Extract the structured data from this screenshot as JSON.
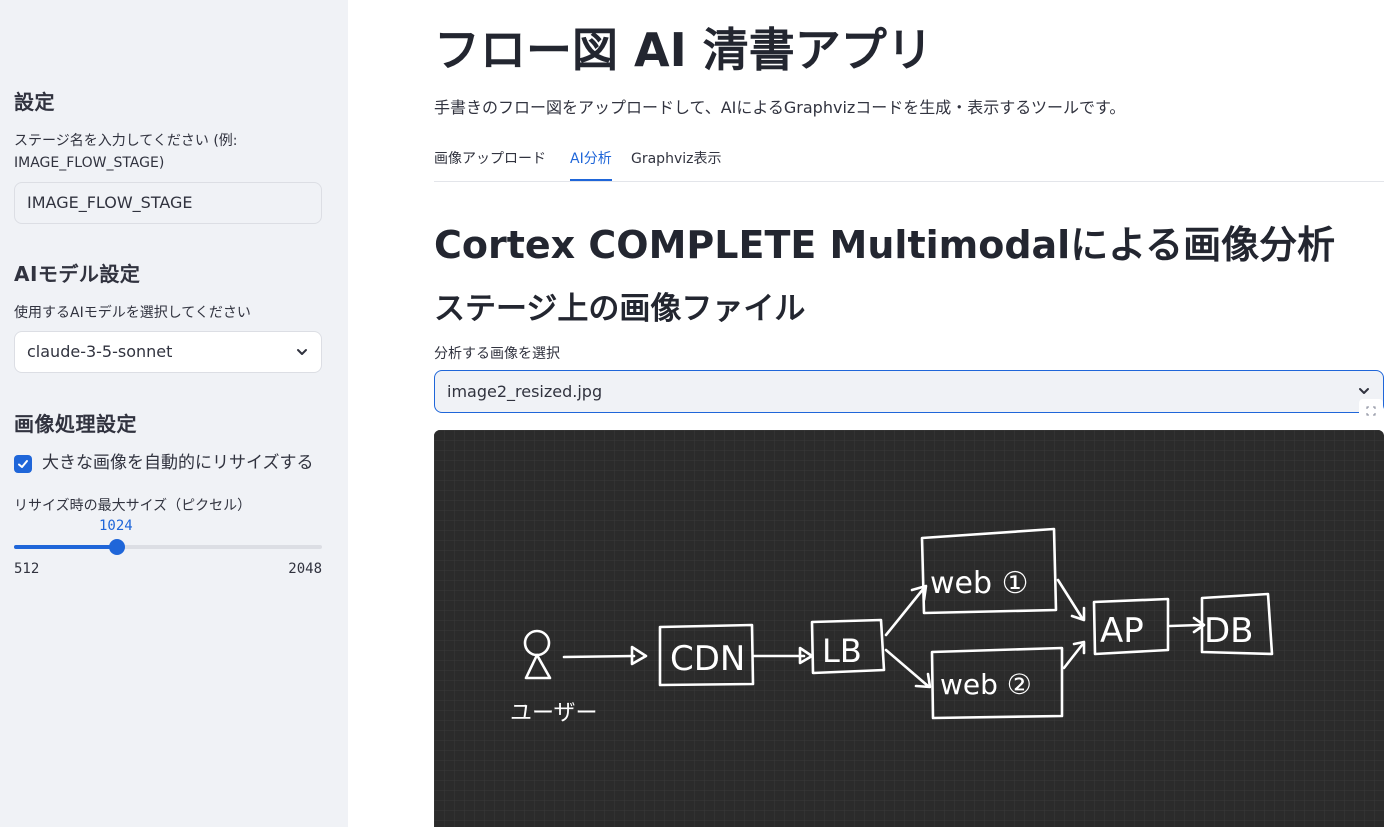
{
  "sidebar": {
    "settings_header": "設定",
    "stage_label": "ステージ名を入力してください (例: IMAGE_FLOW_STAGE)",
    "stage_value": "IMAGE_FLOW_STAGE",
    "model_header": "AIモデル設定",
    "model_label": "使用するAIモデルを選択してください",
    "model_value": "claude-3-5-sonnet",
    "image_header": "画像処理設定",
    "resize_checkbox_label": "大きな画像を自動的にリサイズする",
    "resize_checked": true,
    "slider_label": "リサイズ時の最大サイズ（ピクセル）",
    "slider_value": "1024",
    "slider_min": "512",
    "slider_max": "2048",
    "slider_fraction": 0.3333
  },
  "main": {
    "title": "フロー図 AI 清書アプリ",
    "description": "手書きのフロー図をアップロードして、AIによるGraphvizコードを生成・表示するツールです。",
    "tabs": [
      {
        "label": "画像アップロード",
        "active": false
      },
      {
        "label": "AI分析",
        "active": true
      },
      {
        "label": "Graphviz表示",
        "active": false
      }
    ],
    "section_title": "Cortex COMPLETE Multimodalによる画像分析",
    "subsection_title": "ステージ上の画像ファイル",
    "select_label": "分析する画像を選択",
    "select_value": "image2_resized.jpg"
  },
  "diagram": {
    "user_label": "ユーザー",
    "nodes": [
      "CDN",
      "LB",
      "web ①",
      "web ②",
      "AP",
      "DB"
    ]
  },
  "colors": {
    "accent": "#1f66d9",
    "sidebar_bg": "#f0f2f6",
    "board_bg": "#2b2b2b"
  },
  "icons": {
    "select_chevron": "chevron-down-icon",
    "checkbox_check": "check-icon",
    "fullscreen": "fullscreen-icon"
  }
}
